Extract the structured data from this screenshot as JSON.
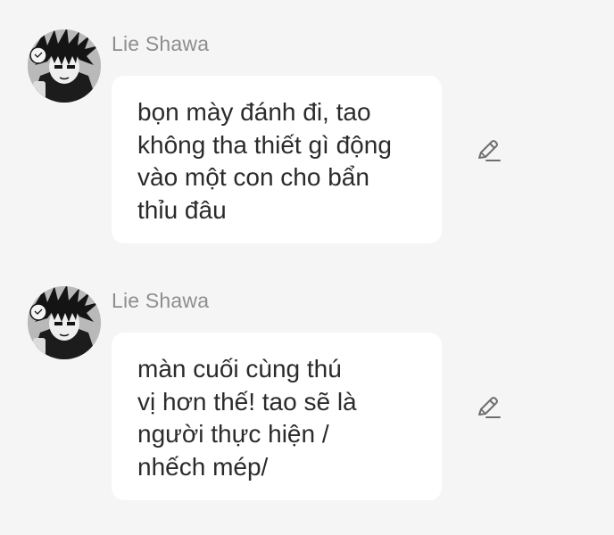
{
  "messages": [
    {
      "sender": "Lie Shawa",
      "text": "bọn mày đánh đi, tao\nkhông tha thiết gì động\nvào một con cho bẩn\nthỉu đâu"
    },
    {
      "sender": "Lie Shawa",
      "text": "màn cuối cùng thú\nvị hơn thế! tao sẽ là\nngười thực hiện /\nnhếch mép/"
    }
  ],
  "icons": {
    "avatar": "manga-character-avatar",
    "edit": "pencil-icon"
  },
  "colors": {
    "background": "#f5f5f5",
    "bubble": "#ffffff",
    "sender_name": "#8e8e8e",
    "text": "#2b2b2b"
  }
}
